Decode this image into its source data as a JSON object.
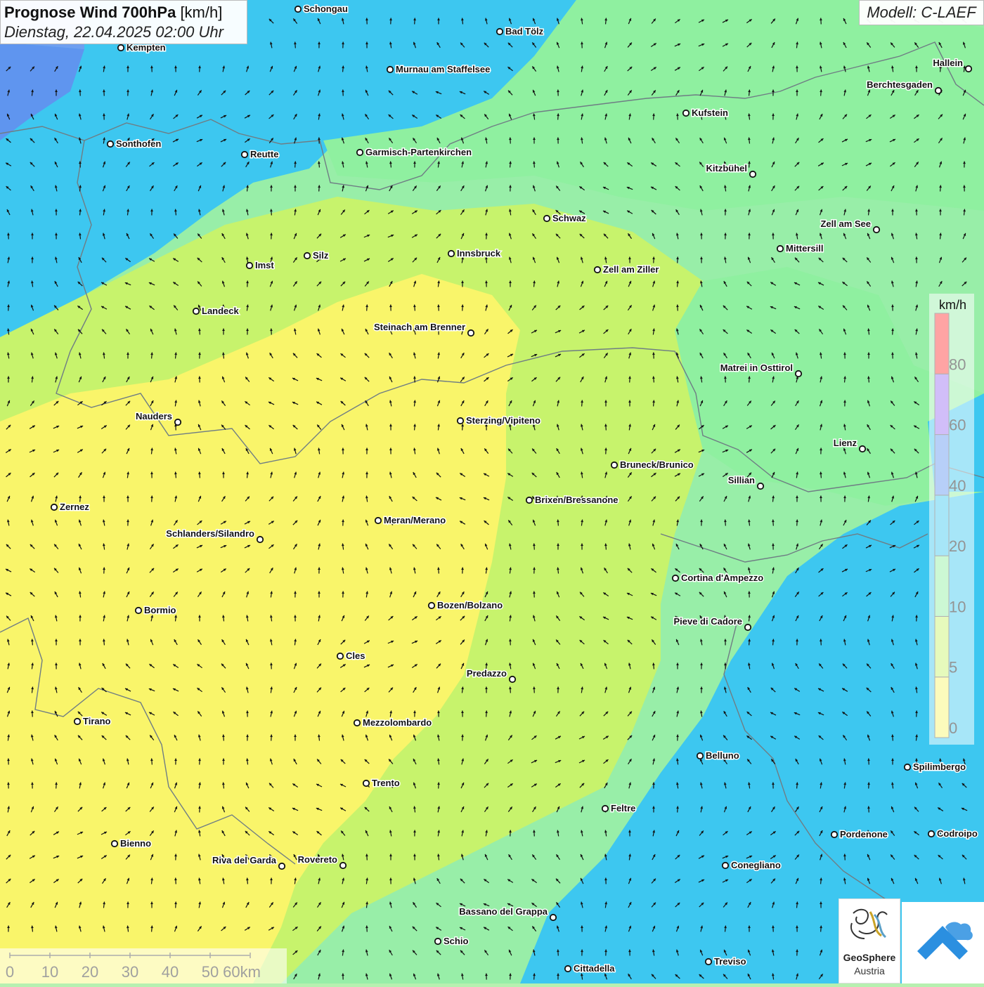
{
  "header": {
    "title_main": "Prognose Wind 700hPa",
    "title_unit": "[km/h]",
    "datetime": "Dienstag, 22.04.2025 02:00 Uhr",
    "model": "Modell: C-LAEF"
  },
  "legend": {
    "unit": "km/h",
    "ticks": [
      "0",
      "5",
      "10",
      "20",
      "40",
      "60",
      "80"
    ],
    "colors": [
      "#f9f56a",
      "#c7f36c",
      "#8ff0a0",
      "#3dc7f0",
      "#5f95ef",
      "#9a6ff2",
      "#ff3535"
    ]
  },
  "scale_bar": {
    "labels": [
      "0",
      "10",
      "20",
      "30",
      "40",
      "50",
      "60km"
    ]
  },
  "branding": {
    "name": "GeoSphere",
    "sub": "Austria"
  },
  "cities": [
    {
      "name": "Schongau",
      "label": "right"
    },
    {
      "name": "Bad Tölz",
      "label": "right"
    },
    {
      "name": "Kempten",
      "label": "right"
    },
    {
      "name": "Murnau am Staffelsee",
      "label": "right"
    },
    {
      "name": "Hallein",
      "label": "left"
    },
    {
      "name": "Berchtesgaden",
      "label": "left"
    },
    {
      "name": "Kufstein",
      "label": "right"
    },
    {
      "name": "Sonthofen",
      "label": "right"
    },
    {
      "name": "Reutte",
      "label": "right"
    },
    {
      "name": "Garmisch-Partenkirchen",
      "label": "right"
    },
    {
      "name": "Kitzbühel",
      "label": "left"
    },
    {
      "name": "Schwaz",
      "label": "right"
    },
    {
      "name": "Zell am See",
      "label": "left"
    },
    {
      "name": "Innsbruck",
      "label": "right"
    },
    {
      "name": "Mittersill",
      "label": "right"
    },
    {
      "name": "Silz",
      "label": "right"
    },
    {
      "name": "Imst",
      "label": "right"
    },
    {
      "name": "Zell am Ziller",
      "label": "right"
    },
    {
      "name": "Landeck",
      "label": "right"
    },
    {
      "name": "Steinach am Brenner",
      "label": "left"
    },
    {
      "name": "Matrei in Osttirol",
      "label": "left"
    },
    {
      "name": "Nauders",
      "label": "left"
    },
    {
      "name": "Sterzing/Vipiteno",
      "label": "right"
    },
    {
      "name": "Lienz",
      "label": "left"
    },
    {
      "name": "Bruneck/Brunico",
      "label": "right"
    },
    {
      "name": "Sillian",
      "label": "left"
    },
    {
      "name": "Zernez",
      "label": "right"
    },
    {
      "name": "Brixen/Bressanone",
      "label": "right"
    },
    {
      "name": "Meran/Merano",
      "label": "right"
    },
    {
      "name": "Schlanders/Silandro",
      "label": "left"
    },
    {
      "name": "Cortina d'Ampezzo",
      "label": "right"
    },
    {
      "name": "Bozen/Bolzano",
      "label": "right"
    },
    {
      "name": "Bormio",
      "label": "right"
    },
    {
      "name": "Pieve di Cadore",
      "label": "left"
    },
    {
      "name": "Cles",
      "label": "right"
    },
    {
      "name": "Predazzo",
      "label": "left"
    },
    {
      "name": "Tirano",
      "label": "right"
    },
    {
      "name": "Mezzolombardo",
      "label": "right"
    },
    {
      "name": "Belluno",
      "label": "right"
    },
    {
      "name": "Spilimbergo",
      "label": "right"
    },
    {
      "name": "Trento",
      "label": "right"
    },
    {
      "name": "Feltre",
      "label": "right"
    },
    {
      "name": "Pordenone",
      "label": "right"
    },
    {
      "name": "Codroipo",
      "label": "right"
    },
    {
      "name": "Bienno",
      "label": "right"
    },
    {
      "name": "Riva del Garda",
      "label": "left"
    },
    {
      "name": "Rovereto",
      "label": "left"
    },
    {
      "name": "Conegliano",
      "label": "right"
    },
    {
      "name": "Bassano del Grappa",
      "label": "left"
    },
    {
      "name": "Schio",
      "label": "right"
    },
    {
      "name": "Treviso",
      "label": "right"
    },
    {
      "name": "Cittadella",
      "label": "right"
    }
  ]
}
